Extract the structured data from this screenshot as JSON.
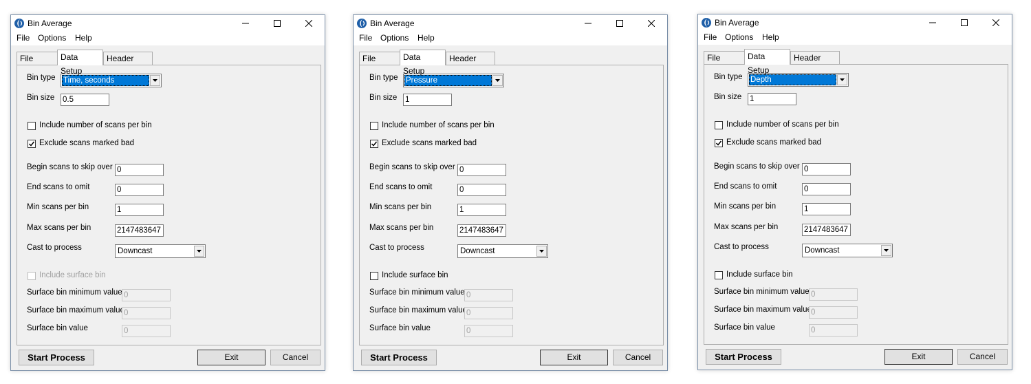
{
  "windows": [
    {
      "title": "Bin Average",
      "menu": [
        "File",
        "Options",
        "Help"
      ],
      "tabs": [
        "File Setup",
        "Data Setup",
        "Header View"
      ],
      "active_tab": "Data Setup",
      "bin_type_label": "Bin type",
      "bin_type_value": "Time, seconds",
      "bin_size_label": "Bin size",
      "bin_size_value": "0.5",
      "include_scans_label": "Include number of scans per bin",
      "include_scans_checked": false,
      "exclude_bad_label": "Exclude scans marked bad",
      "exclude_bad_checked": true,
      "begin_skip_label": "Begin scans to skip over",
      "begin_skip_value": "0",
      "end_omit_label": "End scans to omit",
      "end_omit_value": "0",
      "min_scans_label": "Min scans per bin",
      "min_scans_value": "1",
      "max_scans_label": "Max scans per bin",
      "max_scans_value": "2147483647",
      "cast_label": "Cast to process",
      "cast_value": "Downcast",
      "include_surface_label": "Include surface bin",
      "include_surface_enabled": false,
      "surface_min_label": "Surface bin minimum value",
      "surface_min_value": "0",
      "surface_max_label": "Surface bin maximum value",
      "surface_max_value": "0",
      "surface_val_label": "Surface bin value",
      "surface_val_value": "0",
      "start_label": "Start Process",
      "exit_label": "Exit",
      "cancel_label": "Cancel"
    },
    {
      "title": "Bin Average",
      "menu": [
        "File",
        "Options",
        "Help"
      ],
      "tabs": [
        "File Setup",
        "Data Setup",
        "Header View"
      ],
      "active_tab": "Data Setup",
      "bin_type_label": "Bin type",
      "bin_type_value": "Pressure",
      "bin_size_label": "Bin size",
      "bin_size_value": "1",
      "include_scans_label": "Include number of scans per bin",
      "include_scans_checked": false,
      "exclude_bad_label": "Exclude scans marked bad",
      "exclude_bad_checked": true,
      "begin_skip_label": "Begin scans to skip over",
      "begin_skip_value": "0",
      "end_omit_label": "End scans to omit",
      "end_omit_value": "0",
      "min_scans_label": "Min scans per bin",
      "min_scans_value": "1",
      "max_scans_label": "Max scans per bin",
      "max_scans_value": "2147483647",
      "cast_label": "Cast to process",
      "cast_value": "Downcast",
      "include_surface_label": "Include surface bin",
      "include_surface_enabled": true,
      "surface_min_label": "Surface bin minimum value",
      "surface_min_value": "0",
      "surface_max_label": "Surface bin maximum value",
      "surface_max_value": "0",
      "surface_val_label": "Surface bin value",
      "surface_val_value": "0",
      "start_label": "Start Process",
      "exit_label": "Exit",
      "cancel_label": "Cancel"
    },
    {
      "title": "Bin Average",
      "menu": [
        "File",
        "Options",
        "Help"
      ],
      "tabs": [
        "File Setup",
        "Data Setup",
        "Header View"
      ],
      "active_tab": "Data Setup",
      "bin_type_label": "Bin type",
      "bin_type_value": "Depth",
      "bin_size_label": "Bin size",
      "bin_size_value": "1",
      "include_scans_label": "Include number of scans per bin",
      "include_scans_checked": false,
      "exclude_bad_label": "Exclude scans marked bad",
      "exclude_bad_checked": true,
      "begin_skip_label": "Begin scans to skip over",
      "begin_skip_value": "0",
      "end_omit_label": "End scans to omit",
      "end_omit_value": "0",
      "min_scans_label": "Min scans per bin",
      "min_scans_value": "1",
      "max_scans_label": "Max scans per bin",
      "max_scans_value": "2147483647",
      "cast_label": "Cast to process",
      "cast_value": "Downcast",
      "include_surface_label": "Include surface bin",
      "include_surface_enabled": true,
      "surface_min_label": "Surface bin minimum value",
      "surface_min_value": "0",
      "surface_max_label": "Surface bin maximum value",
      "surface_max_value": "0",
      "surface_val_label": "Surface bin value",
      "surface_val_value": "0",
      "start_label": "Start Process",
      "exit_label": "Exit",
      "cancel_label": "Cancel"
    }
  ],
  "colors": {
    "selection": "#0078d7",
    "window_bg": "#f0f0f0",
    "disabled_text": "#a0a0a0",
    "icon_blue": "#1f5fa8"
  },
  "icons": [
    "app-logo-icon",
    "minimize-icon",
    "maximize-icon",
    "close-icon",
    "dropdown-arrow-icon",
    "checkmark-icon"
  ]
}
